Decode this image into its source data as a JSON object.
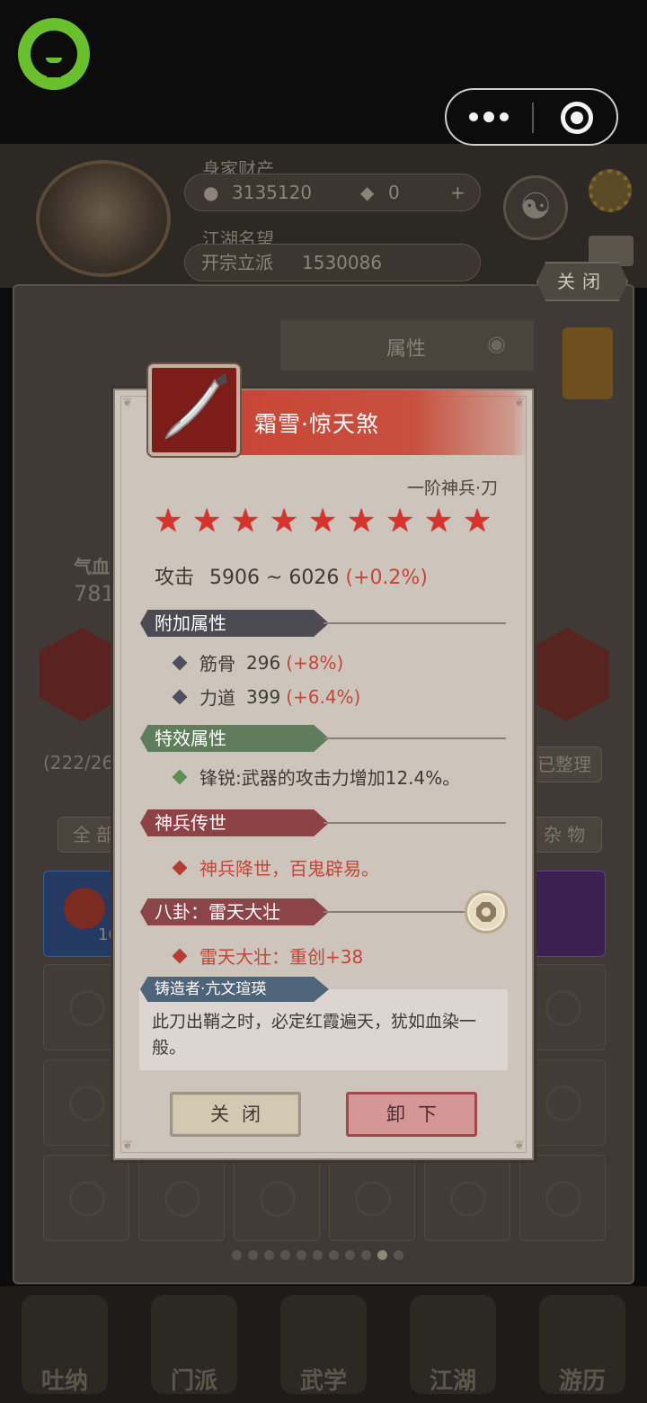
{
  "chrome": {
    "capsule_more": "more-dots-icon",
    "capsule_target": "target-icon"
  },
  "background": {
    "wealth_label": "身家财产",
    "silver": "3135120",
    "gold": "0",
    "plus": "+",
    "fame_label": "江湖名望",
    "fame_rank": "开宗立派",
    "fame_value": "1530086",
    "close_label": "关闭",
    "attr_tab": "属性",
    "hp_label": "气血",
    "hp_value": "781",
    "bag_count": "(222/264",
    "sort_label": "已整理",
    "tab_all": "全 部",
    "tab_misc": "杂 物",
    "slot_count": "10",
    "nav": [
      "吐纳",
      "门派",
      "武学",
      "江湖",
      "游历"
    ]
  },
  "modal": {
    "item_name": "霜雪·惊天煞",
    "item_type": "一阶神兵·刀",
    "stars": 9,
    "attack_label": "攻击",
    "attack_range": "5906 ~ 6026",
    "attack_bonus": "(+0.2%)",
    "sections": {
      "extra": {
        "title": "附加属性",
        "rows": [
          {
            "name": "筋骨",
            "value": "296",
            "bonus": "(+8%)"
          },
          {
            "name": "力道",
            "value": "399",
            "bonus": "(+6.4%)"
          }
        ]
      },
      "special": {
        "title": "特效属性",
        "text": "锋锐:武器的攻击力增加12.4%。"
      },
      "legend": {
        "title": "神兵传世",
        "text": "神兵降世，百鬼辟易。"
      },
      "bagua": {
        "title": "八卦：雷天大壮",
        "text": "雷天大壮：重创+38"
      },
      "forger": {
        "title": "铸造者·亢文瑄瑛",
        "text": "此刀出鞘之时，必定红霞遍天，犹如血染一般。"
      }
    },
    "buttons": {
      "close": "关闭",
      "unequip": "卸下"
    }
  },
  "colors": {
    "accent_red": "#c44637",
    "title_bar": "#c94636",
    "wechat_green": "#6abf2d"
  }
}
